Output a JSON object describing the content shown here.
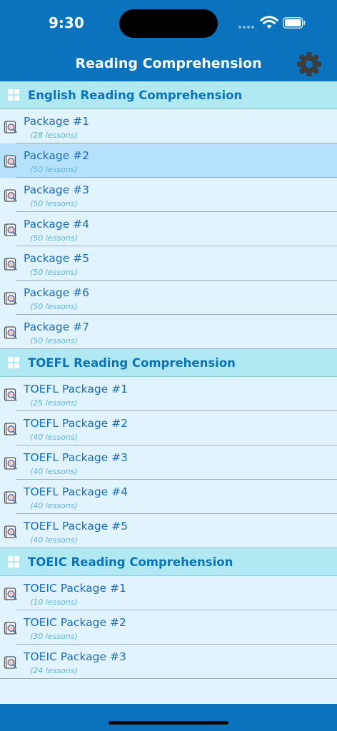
{
  "status_bar": {
    "time": "9:30"
  },
  "nav": {
    "title": "Reading Comprehension",
    "settings_icon": "gear-icon"
  },
  "colors": {
    "primary": "#0b72bd",
    "section_bg": "#b1e9f3",
    "row_bg": "#e1f3fd",
    "selected_bg": "#b5e2fa"
  },
  "sections": [
    {
      "title": "English Reading Comprehension",
      "items": [
        {
          "title": "Package #1",
          "lessons": "(28 lessons)"
        },
        {
          "title": "Package #2",
          "lessons": "(50 lessons)",
          "selected": true
        },
        {
          "title": "Package #3",
          "lessons": "(50 lessons)"
        },
        {
          "title": "Package #4",
          "lessons": "(50 lessons)"
        },
        {
          "title": "Package #5",
          "lessons": "(50 lessons)"
        },
        {
          "title": "Package #6",
          "lessons": "(50 lessons)"
        },
        {
          "title": "Package #7",
          "lessons": "(50 lessons)"
        }
      ]
    },
    {
      "title": "TOEFL Reading Comprehension",
      "items": [
        {
          "title": "TOEFL Package #1",
          "lessons": "(25 lessons)"
        },
        {
          "title": "TOEFL Package #2",
          "lessons": "(40 lessons)"
        },
        {
          "title": "TOEFL Package #3",
          "lessons": "(40 lessons)"
        },
        {
          "title": "TOEFL Package #4",
          "lessons": "(40 lessons)"
        },
        {
          "title": "TOEFL Package #5",
          "lessons": "(40 lessons)"
        }
      ]
    },
    {
      "title": "TOEIC Reading Comprehension",
      "items": [
        {
          "title": "TOEIC Package #1",
          "lessons": "(10 lessons)"
        },
        {
          "title": "TOEIC Package #2",
          "lessons": "(30 lessons)"
        },
        {
          "title": "TOEIC Package #3",
          "lessons": "(24 lessons)"
        }
      ]
    }
  ]
}
